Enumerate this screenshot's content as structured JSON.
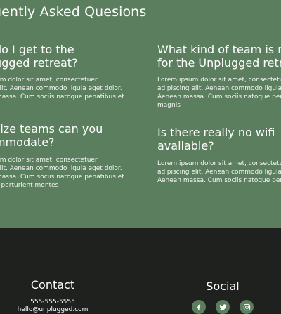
{
  "faq": {
    "title": "uently Asked Quesions",
    "items": [
      {
        "q1": "do I get to the",
        "q2": "ugged retreat?",
        "a1": "um dolor sit amet, consectetuer",
        "a2": "elit. Aenean commodo ligula eget dolor.",
        "a3": "massa. Cum sociis natoque penatibus et"
      },
      {
        "q1": "What kind of team is rig",
        "q2": "for the Unplugged retreat",
        "a1": "Lorem ipsum dolor sit amet, consectetuer",
        "a2": "adipiscing elit. Aenean commodo ligula eg",
        "a3": "Aenean massa. Cum sociis natoque penatib",
        "a4": "magnis"
      },
      {
        "q1": "size teams can you",
        "q2": "mmodate?",
        "a1": "um dolor sit amet, consectetuer",
        "a2": "elit. Aenean commodo ligula eget dolor.",
        "a3": "massa. Cum sociis natoque penatibus et",
        "a4": "s parturient montes"
      },
      {
        "q1": "Is there really no wifi",
        "q2": "available?",
        "a1": "Lorem ipsum dolor sit amet, consectetuer",
        "a2": "adipiscing elit. Aenean commodo ligula eg",
        "a3": "Aenean massa. Cum sociis natoque penatib"
      }
    ]
  },
  "footer": {
    "contact": {
      "heading": "Contact",
      "phone": "555-555-5555",
      "email": "hello@unplugged.com"
    },
    "social": {
      "heading": "Social",
      "links": [
        {
          "icon": "facebook-icon"
        },
        {
          "icon": "twitter-icon"
        },
        {
          "icon": "instagram-icon"
        }
      ]
    }
  },
  "colors": {
    "faq_bg": "#5b7f5e",
    "footer_bg": "#1f211f",
    "text": "#ffffff",
    "accent": "#5b7f5e"
  }
}
